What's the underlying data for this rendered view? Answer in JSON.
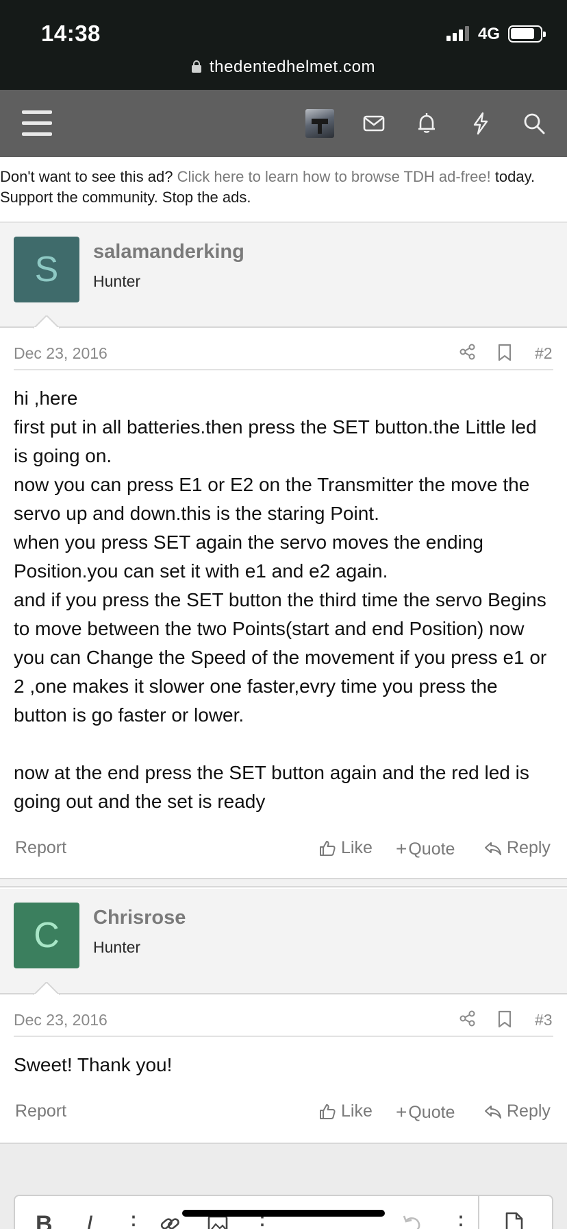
{
  "status_bar": {
    "time": "14:38",
    "network": "4G",
    "url": "thedentedhelmet.com"
  },
  "navbar": {
    "icons": [
      "menu-icon",
      "user-avatar",
      "envelope-icon",
      "bell-icon",
      "bolt-icon",
      "search-icon"
    ]
  },
  "ad_notice": {
    "prefix": "Don't want to see this ad? ",
    "link": "Click here to learn how to browse TDH ad-free!",
    "suffix": " today.",
    "line2": "Support the community. Stop the ads."
  },
  "posts": [
    {
      "avatar_letter": "S",
      "avatar_color": "#3f6b6b",
      "avatar_text_color": "#8ec9c4",
      "username": "salamanderking",
      "user_title": "Hunter",
      "date": "Dec 23, 2016",
      "number": "#2",
      "body": [
        "hi ,here",
        "first put in all batteries.then press the SET button.the Little led is going on.",
        "now you can press E1 or E2 on the Transmitter the move the servo up and down.this is the staring Point.",
        "when you press SET again the servo moves the ending Position.you can set it with e1 and e2 again.",
        "and if you press the SET button the third time the servo Begins to move between the two Points(start and end Position) now you can Change the Speed of the movement if you press e1 or 2 ,one makes it slower one faster,evry time you press the button is go faster or lower.",
        "",
        "now at the end press the SET button again and the red led is going out and the set is ready"
      ],
      "actions": {
        "report": "Report",
        "like": "Like",
        "quote": "Quote",
        "reply": "Reply"
      }
    },
    {
      "avatar_letter": "C",
      "avatar_color": "#3b7f5e",
      "avatar_text_color": "#a8e6c7",
      "username": "Chrisrose",
      "user_title": "Hunter",
      "date": "Dec 23, 2016",
      "number": "#3",
      "body": [
        "Sweet! Thank you!"
      ],
      "actions": {
        "report": "Report",
        "like": "Like",
        "quote": "Quote",
        "reply": "Reply"
      }
    }
  ],
  "editor": {
    "bold": "B",
    "italic": "I",
    "more": "⋮"
  }
}
